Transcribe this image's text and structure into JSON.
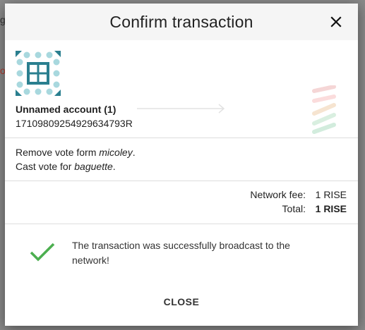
{
  "background": {
    "peek_left_char": "g",
    "peek_left_dot": "o"
  },
  "dialog": {
    "title": "Confirm transaction",
    "close_icon": "close-icon",
    "close_button_label": "CLOSE"
  },
  "account": {
    "name": "Unnamed account (1)",
    "address": "17109809254929634793R"
  },
  "votes": {
    "remove_prefix": "Remove vote form ",
    "remove_name": "micoley",
    "remove_suffix": ".",
    "cast_prefix": "Cast vote for ",
    "cast_name": "baguette",
    "cast_suffix": "."
  },
  "fees": {
    "network_fee_label": "Network fee:",
    "network_fee_value": "1 RISE",
    "total_label": "Total:",
    "total_value": "1 RISE"
  },
  "status": {
    "message": "The transaction was successfully broadcast to the network!",
    "icon": "checkmark-icon",
    "color": "#4caf50"
  },
  "colors": {
    "header_bg": "#f5f5f5",
    "identicon_primary": "#2a7f8f",
    "identicon_light": "#a8d8de"
  }
}
